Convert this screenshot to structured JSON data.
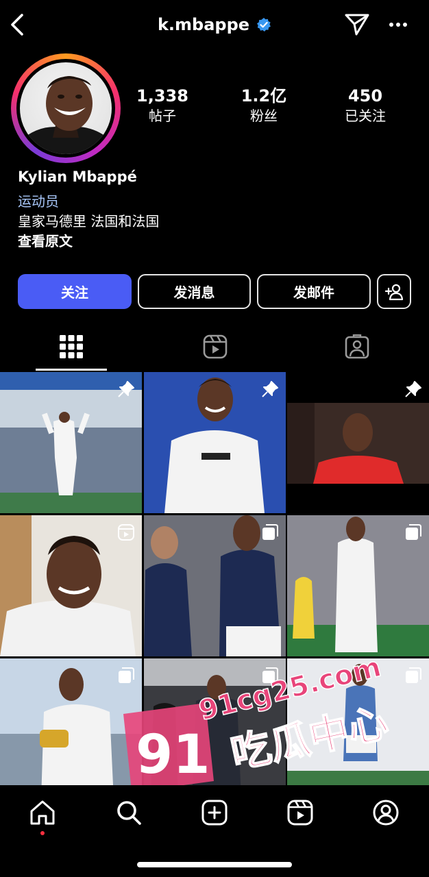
{
  "header": {
    "username": "k.mbappe",
    "verified": true
  },
  "stats": [
    {
      "value": "1,338",
      "label": "帖子"
    },
    {
      "value": "1.2亿",
      "label": "粉丝"
    },
    {
      "value": "450",
      "label": "已关注"
    }
  ],
  "profile": {
    "name": "Kylian Mbappé",
    "category": "运动员",
    "bio": "皇家马德里 法国和法国",
    "translate": "查看原文"
  },
  "buttons": {
    "follow": "关注",
    "message": "发消息",
    "email": "发邮件"
  },
  "watermark": {
    "number": "91",
    "site": "91cg25.com",
    "name": "吃瓜中心"
  },
  "colors": {
    "accent": "#4a5cf5",
    "category": "#a8c7fa",
    "verified": "#3897f0"
  }
}
